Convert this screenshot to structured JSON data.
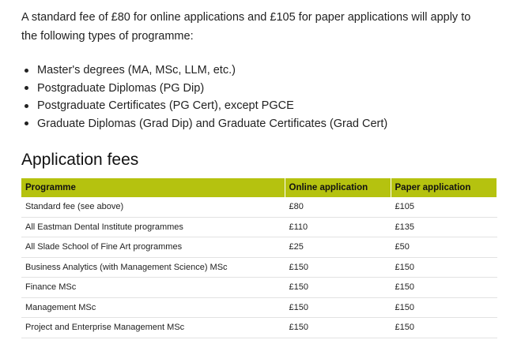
{
  "intro": {
    "text": "A standard fee of £80 for online applications and £105 for paper applications will apply to the following types of programme:"
  },
  "programme_types": [
    "Master's degrees (MA, MSc, LLM, etc.)",
    "Postgraduate Diplomas (PG Dip)",
    "Postgraduate Certificates (PG Cert), except PGCE",
    "Graduate Diplomas (Grad Dip) and Graduate Certificates (Grad Cert)"
  ],
  "section": {
    "title": "Application fees"
  },
  "fees_table": {
    "header_color": "#b5c20f",
    "columns": [
      "Programme",
      "Online application",
      "Paper application"
    ],
    "rows": [
      [
        "Standard fee (see above)",
        "£80",
        "£105"
      ],
      [
        "All Eastman Dental Institute programmes",
        "£110",
        "£135"
      ],
      [
        "All Slade School of Fine Art programmes",
        "£25",
        "£50"
      ],
      [
        "Business Analytics (with Management Science) MSc",
        "£150",
        "£150"
      ],
      [
        "Finance MSc",
        "£150",
        "£150"
      ],
      [
        "Management MSc",
        "£150",
        "£150"
      ],
      [
        "Project and Enterprise Management MSc",
        "£150",
        "£150"
      ]
    ]
  }
}
